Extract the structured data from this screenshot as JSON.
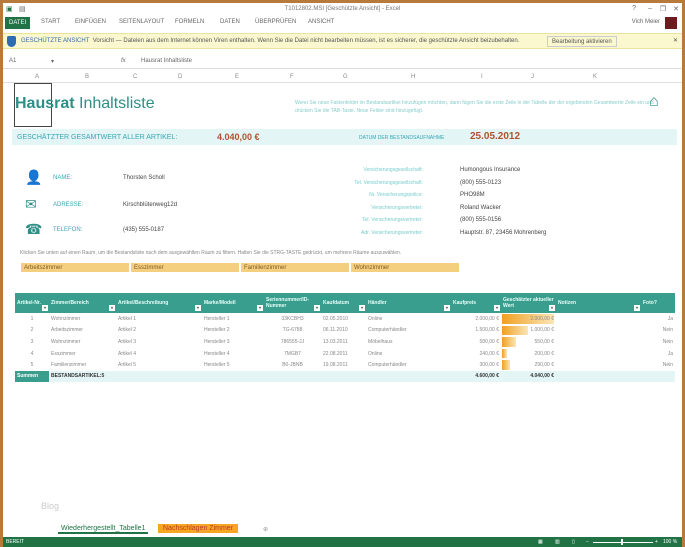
{
  "window": {
    "title": "T1012802.MSI  [Geschützte Ansicht] - Excel",
    "user": "Vich Meier"
  },
  "ribbon": {
    "tabs": [
      "DATEI",
      "START",
      "EINFÜGEN",
      "SEITENLAYOUT",
      "FORMELN",
      "DATEN",
      "ÜBERPRÜFEN",
      "ANSICHT"
    ]
  },
  "protected": {
    "label": "GESCHÜTZTE ANSICHT",
    "message": "Vorsicht — Dateien aus dem Internet können Viren enthalten. Wenn Sie die Datei nicht bearbeiten müssen, ist es sicherer, die geschützte Ansicht beizubehalten.",
    "button": "Bearbeitung aktivieren"
  },
  "formula": {
    "cell": "A1",
    "fx": "fx",
    "value": "Hausrat Inhaltsliste"
  },
  "columns": [
    "A",
    "B",
    "C",
    "D",
    "E",
    "F",
    "G",
    "H",
    "I",
    "J",
    "K"
  ],
  "sheet": {
    "title_bold": "Hausrat",
    "title_rest": " Inhaltsliste",
    "hint": "Wenn Sie neue Faktenfelder im Bestandsartikel hinzufügen möchten, dann fügen Sie die erste Zeile in der Tabelle der der ergebenden Gesamtwerte Zeile ein und drücken Sie die TAB-Taste. Neue Felder sind hinzugefügt.",
    "total_label": "GESCHÄTZTER GESAMTWERT ALLER ARTIKEL:",
    "total_value": "4.040,00 €",
    "date_label": "DATUM DER BESTANDSAUFNAHME",
    "date_value": "25.05.2012",
    "owner": [
      {
        "label": "NAME:",
        "value": "Thorsten Scholl",
        "icon": "person-icon"
      },
      {
        "label": "ADRESSE:",
        "value": "Kirschblütenweg12d",
        "icon": "envelope-icon"
      },
      {
        "label": "TELEFON:",
        "value": "(435) 555-0187",
        "icon": "phone-icon"
      }
    ],
    "insurance": [
      {
        "label": "Versicherungsgesellschaft:",
        "value": "Humongous Insurance"
      },
      {
        "label": "Tel. Versicherungsgesellschaft:",
        "value": "(800) 555-0123"
      },
      {
        "label": "Nr. Versicherungspolice:",
        "value": "PHO98M"
      },
      {
        "label": "Versicherungsvertreter:",
        "value": "Roland Wacker"
      },
      {
        "label": "Tel. Versicherungsvertreter:",
        "value": "(800) 555-0156"
      },
      {
        "label": "Adr. Versicherungsvertreter:",
        "value": "Hauptstr. 87, 23456 Mohrenberg"
      }
    ],
    "instruction": "Klicken Sie unten auf einen Raum, um die Bestandsliste nach dem ausgewählten Raum zu filtern. Halten Sie die STRG-TASTE gedrückt, um mehrere Räume auszuwählen.",
    "rooms": [
      "Arbeitszimmer",
      "Esszimmer",
      "Familienzimmer",
      "Wohnzimmer"
    ],
    "blog": "Blog"
  },
  "table": {
    "headers": [
      "Artikel-Nr.",
      "Zimmer/Bereich",
      "Artikel/Beschreibung",
      "Marke/Modell",
      "Seriennummer/ID-Nummer",
      "Kaufdatum",
      "Händler",
      "Kaufpreis",
      "Geschätzter aktueller Wert",
      "Notizen",
      "Foto?"
    ],
    "rows": [
      [
        "1",
        "Wohnzimmer",
        "Artikel 1",
        "Hersteller 1",
        "33KCBH3",
        "02.05.2010",
        "Online",
        "2.000,00 €",
        "2.000,00 €",
        "",
        "Ja"
      ],
      [
        "2",
        "Arbeitszimmer",
        "Artikel 2",
        "Hersteller 2",
        "TG-6788",
        "06.11.2010",
        "Computerhändler",
        "1.500,00 €",
        "1.000,00 €",
        "",
        "Nein"
      ],
      [
        "3",
        "Wohnzimmer",
        "Artikel 3",
        "Hersteller 3",
        "786555-JJ",
        "13.03.2011",
        "Möbelhaus",
        "580,00 €",
        "550,00 €",
        "",
        "Nein"
      ],
      [
        "4",
        "Esszimmer",
        "Artikel 4",
        "Hersteller 4",
        "7MGB7",
        "22.08.2011",
        "Online",
        "240,00 €",
        "200,00 €",
        "",
        "Ja"
      ],
      [
        "5",
        "Familienzimmer",
        "Artikel 5",
        "Hersteller 5",
        "B0-JBNB",
        "19.08.2011",
        "Computerhändler",
        "300,00 €",
        "290,00 €",
        "",
        "Nein"
      ]
    ],
    "value_fraction": [
      1.0,
      0.5,
      0.275,
      0.1,
      0.145
    ],
    "summary": {
      "label": "Summen",
      "count": "BESTANDSARTIKEL:5",
      "purchase": "4.600,00 €",
      "value": "4.040,00 €"
    }
  },
  "sheettabs": [
    "Wiederhergestellt_Tabelle1",
    "Nachschlagen Zimmer"
  ],
  "status": {
    "ready": "BEREIT",
    "zoom": "100 %"
  },
  "colors": {
    "accent": "#3a9e8f",
    "excel_green": "#217346",
    "value_red": "#b5502d",
    "slicer": "#f5cf80"
  }
}
